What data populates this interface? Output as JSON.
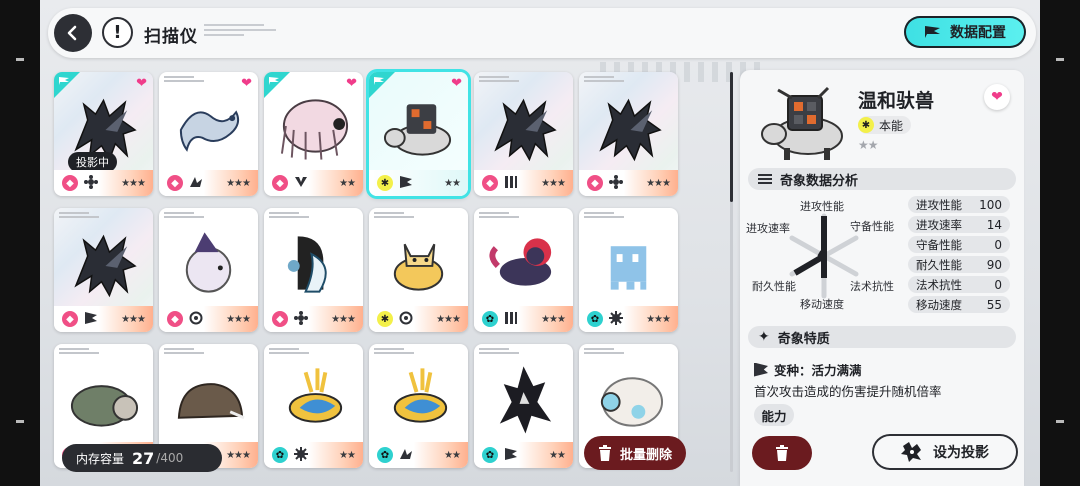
{
  "header": {
    "title": "扫描仪",
    "back_icon": "back-arrow-icon",
    "help_icon": "help-icon",
    "data_config_label": "数据配置"
  },
  "cards": [
    {
      "type": "pink",
      "type_glyph": "◆",
      "ability": "flower",
      "stars": "★★★",
      "favorite": true,
      "projected": true,
      "holo": true,
      "projecting_label": "投影中",
      "creature": "dragon-dark"
    },
    {
      "type": "pink",
      "type_glyph": "◆",
      "ability": "wing",
      "stars": "★★★",
      "favorite": true,
      "projected": false,
      "holo": false,
      "creature": "serpent-dragon"
    },
    {
      "type": "pink",
      "type_glyph": "◆",
      "ability": "v",
      "stars": "★★",
      "favorite": true,
      "projected": true,
      "holo": false,
      "creature": "yak"
    },
    {
      "type": "yellow",
      "type_glyph": "✱",
      "ability": "flag",
      "stars": "★★",
      "favorite": true,
      "projected": true,
      "holo": false,
      "selected": true,
      "creature": "armored-beast"
    },
    {
      "type": "pink",
      "type_glyph": "◆",
      "ability": "claw",
      "stars": "★★★",
      "favorite": false,
      "projected": false,
      "holo": true,
      "creature": "dragon-dark"
    },
    {
      "type": "pink",
      "type_glyph": "◆",
      "ability": "flower",
      "stars": "★★★",
      "favorite": false,
      "projected": false,
      "holo": true,
      "creature": "dragon-dark"
    },
    {
      "type": "pink",
      "type_glyph": "◆",
      "ability": "flag",
      "stars": "★★★",
      "favorite": false,
      "projected": false,
      "holo": true,
      "creature": "dragon-dark"
    },
    {
      "type": "pink",
      "type_glyph": "◆",
      "ability": "swirl",
      "stars": "★★★",
      "favorite": false,
      "projected": false,
      "holo": false,
      "creature": "sheep-witch"
    },
    {
      "type": "pink",
      "type_glyph": "◆",
      "ability": "flower",
      "stars": "★★★",
      "favorite": false,
      "projected": false,
      "holo": false,
      "creature": "mermaid"
    },
    {
      "type": "yellow",
      "type_glyph": "✱",
      "ability": "swirl",
      "stars": "★★★",
      "favorite": false,
      "projected": false,
      "holo": false,
      "creature": "cat"
    },
    {
      "type": "teal",
      "type_glyph": "✿",
      "ability": "claw",
      "stars": "★★★",
      "favorite": false,
      "projected": false,
      "holo": false,
      "creature": "wolf-red"
    },
    {
      "type": "teal",
      "type_glyph": "✿",
      "ability": "gear",
      "stars": "★★★",
      "favorite": false,
      "projected": false,
      "holo": false,
      "creature": "pixel-ghost"
    },
    {
      "type": "pink",
      "type_glyph": "◆",
      "ability": "flower",
      "stars": "★★★",
      "favorite": false,
      "projected": false,
      "holo": false,
      "creature": "turtle-bear"
    },
    {
      "type": "pink",
      "type_glyph": "◆",
      "ability": "flower",
      "stars": "★★★",
      "favorite": false,
      "projected": false,
      "holo": false,
      "creature": "boar"
    },
    {
      "type": "teal",
      "type_glyph": "✿",
      "ability": "gear",
      "stars": "★★",
      "favorite": false,
      "projected": false,
      "holo": false,
      "creature": "parrot"
    },
    {
      "type": "teal",
      "type_glyph": "✿",
      "ability": "wing",
      "stars": "★★",
      "favorite": false,
      "projected": false,
      "holo": false,
      "creature": "parrot"
    },
    {
      "type": "teal",
      "type_glyph": "✿",
      "ability": "flag",
      "stars": "★★",
      "favorite": false,
      "projected": false,
      "holo": false,
      "creature": "shadow"
    },
    {
      "type": "teal",
      "type_glyph": "✿",
      "ability": "flag",
      "stars": "★★",
      "favorite": false,
      "projected": false,
      "holo": false,
      "creature": "headphone-sheep"
    }
  ],
  "storage": {
    "label": "内存容量",
    "count": "27",
    "total": "/400"
  },
  "batch_delete_label": "批量删除",
  "detail": {
    "name": "温和驮兽",
    "type_label": "本能",
    "stars": "★★",
    "analysis_title": "奇象数据分析",
    "radar_labels": {
      "top": "进攻性能",
      "top_right": "守备性能",
      "top_left": "进攻速率",
      "bottom_left": "耐久性能",
      "bottom_right": "法术抗性",
      "bottom": "移动速度"
    },
    "stats": [
      {
        "label": "进攻性能",
        "value": "100"
      },
      {
        "label": "进攻速率",
        "value": "14"
      },
      {
        "label": "守备性能",
        "value": "0"
      },
      {
        "label": "耐久性能",
        "value": "90"
      },
      {
        "label": "法术抗性",
        "value": "0"
      },
      {
        "label": "移动速度",
        "value": "55"
      }
    ],
    "traits_title": "奇象特质",
    "trait_name": "变种：活力满满",
    "trait_desc": "首次攻击造成的伤害提升随机倍率",
    "ability_title": "能力"
  },
  "set_projection_label": "设为投影",
  "colors": {
    "accent": "#41e3e5",
    "pink": "#f04f86",
    "danger": "#6b1b1f"
  }
}
